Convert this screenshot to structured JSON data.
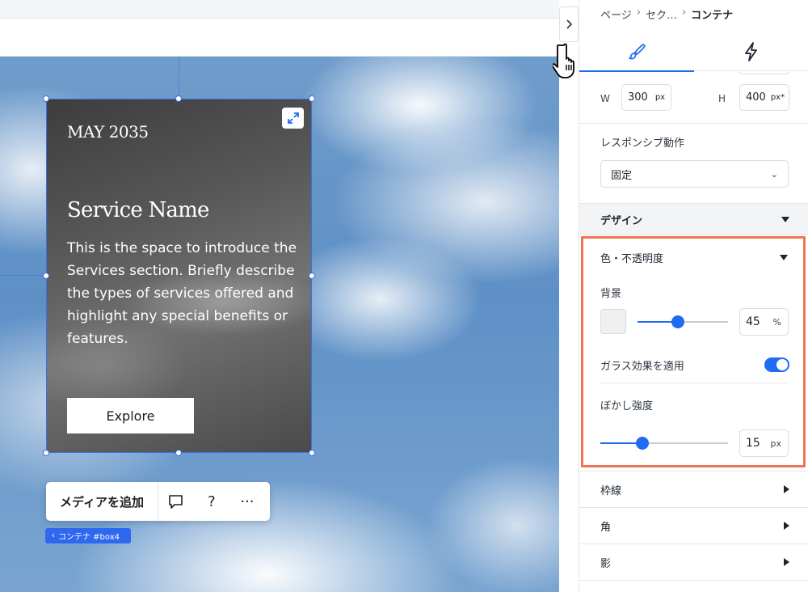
{
  "canvas": {
    "card": {
      "date": "MAY 2035",
      "title": "Service Name",
      "body": "This is the space to introduce the Services section. Briefly describe the types of services offered and highlight any special benefits or features.",
      "button_label": "Explore"
    },
    "float_bar": {
      "add_media_label": "メディアを追加",
      "help_label": "?",
      "more_label": "···"
    },
    "element_tag": {
      "chevron": "‹",
      "label": "コンテナ #box4"
    },
    "icons": [
      "expand-icon",
      "comment-icon",
      "chevron-right-icon",
      "pointer-hand-icon"
    ]
  },
  "panel": {
    "breadcrumb": {
      "page": "ページ",
      "separator": "›",
      "section": "セク…",
      "current": "コンテナ"
    },
    "tabs": [
      {
        "name": "design",
        "icon": "paintbrush-icon",
        "active": true
      },
      {
        "name": "interactions",
        "icon": "lightning-icon",
        "active": false
      }
    ],
    "size": {
      "w_label": "W",
      "w_value": "300",
      "w_unit": "px",
      "h_label": "H",
      "h_value": "400",
      "h_unit": "px*"
    },
    "responsive": {
      "label": "レスポンシブ動作",
      "selected": "固定",
      "chevron": "⌄"
    },
    "design_section": {
      "title": "デザイン",
      "color_opacity": {
        "title": "色・不透明度",
        "background_label": "背景",
        "swatch_color": "#f0f0f0",
        "opacity_value": "45",
        "opacity_unit": "%",
        "opacity_fraction": 0.45
      },
      "glass": {
        "label": "ガラス効果を適用",
        "enabled": true
      },
      "blur": {
        "label": "ぼかし強度",
        "value": "15",
        "unit": "px",
        "fraction": 0.33
      }
    },
    "collapsed_sections": [
      {
        "label": "枠線"
      },
      {
        "label": "角"
      },
      {
        "label": "影"
      }
    ]
  },
  "colors": {
    "accent": "#1f6bf2",
    "selection": "#3b6fe0",
    "highlight": "#f17458",
    "tag": "#2f68f0"
  }
}
